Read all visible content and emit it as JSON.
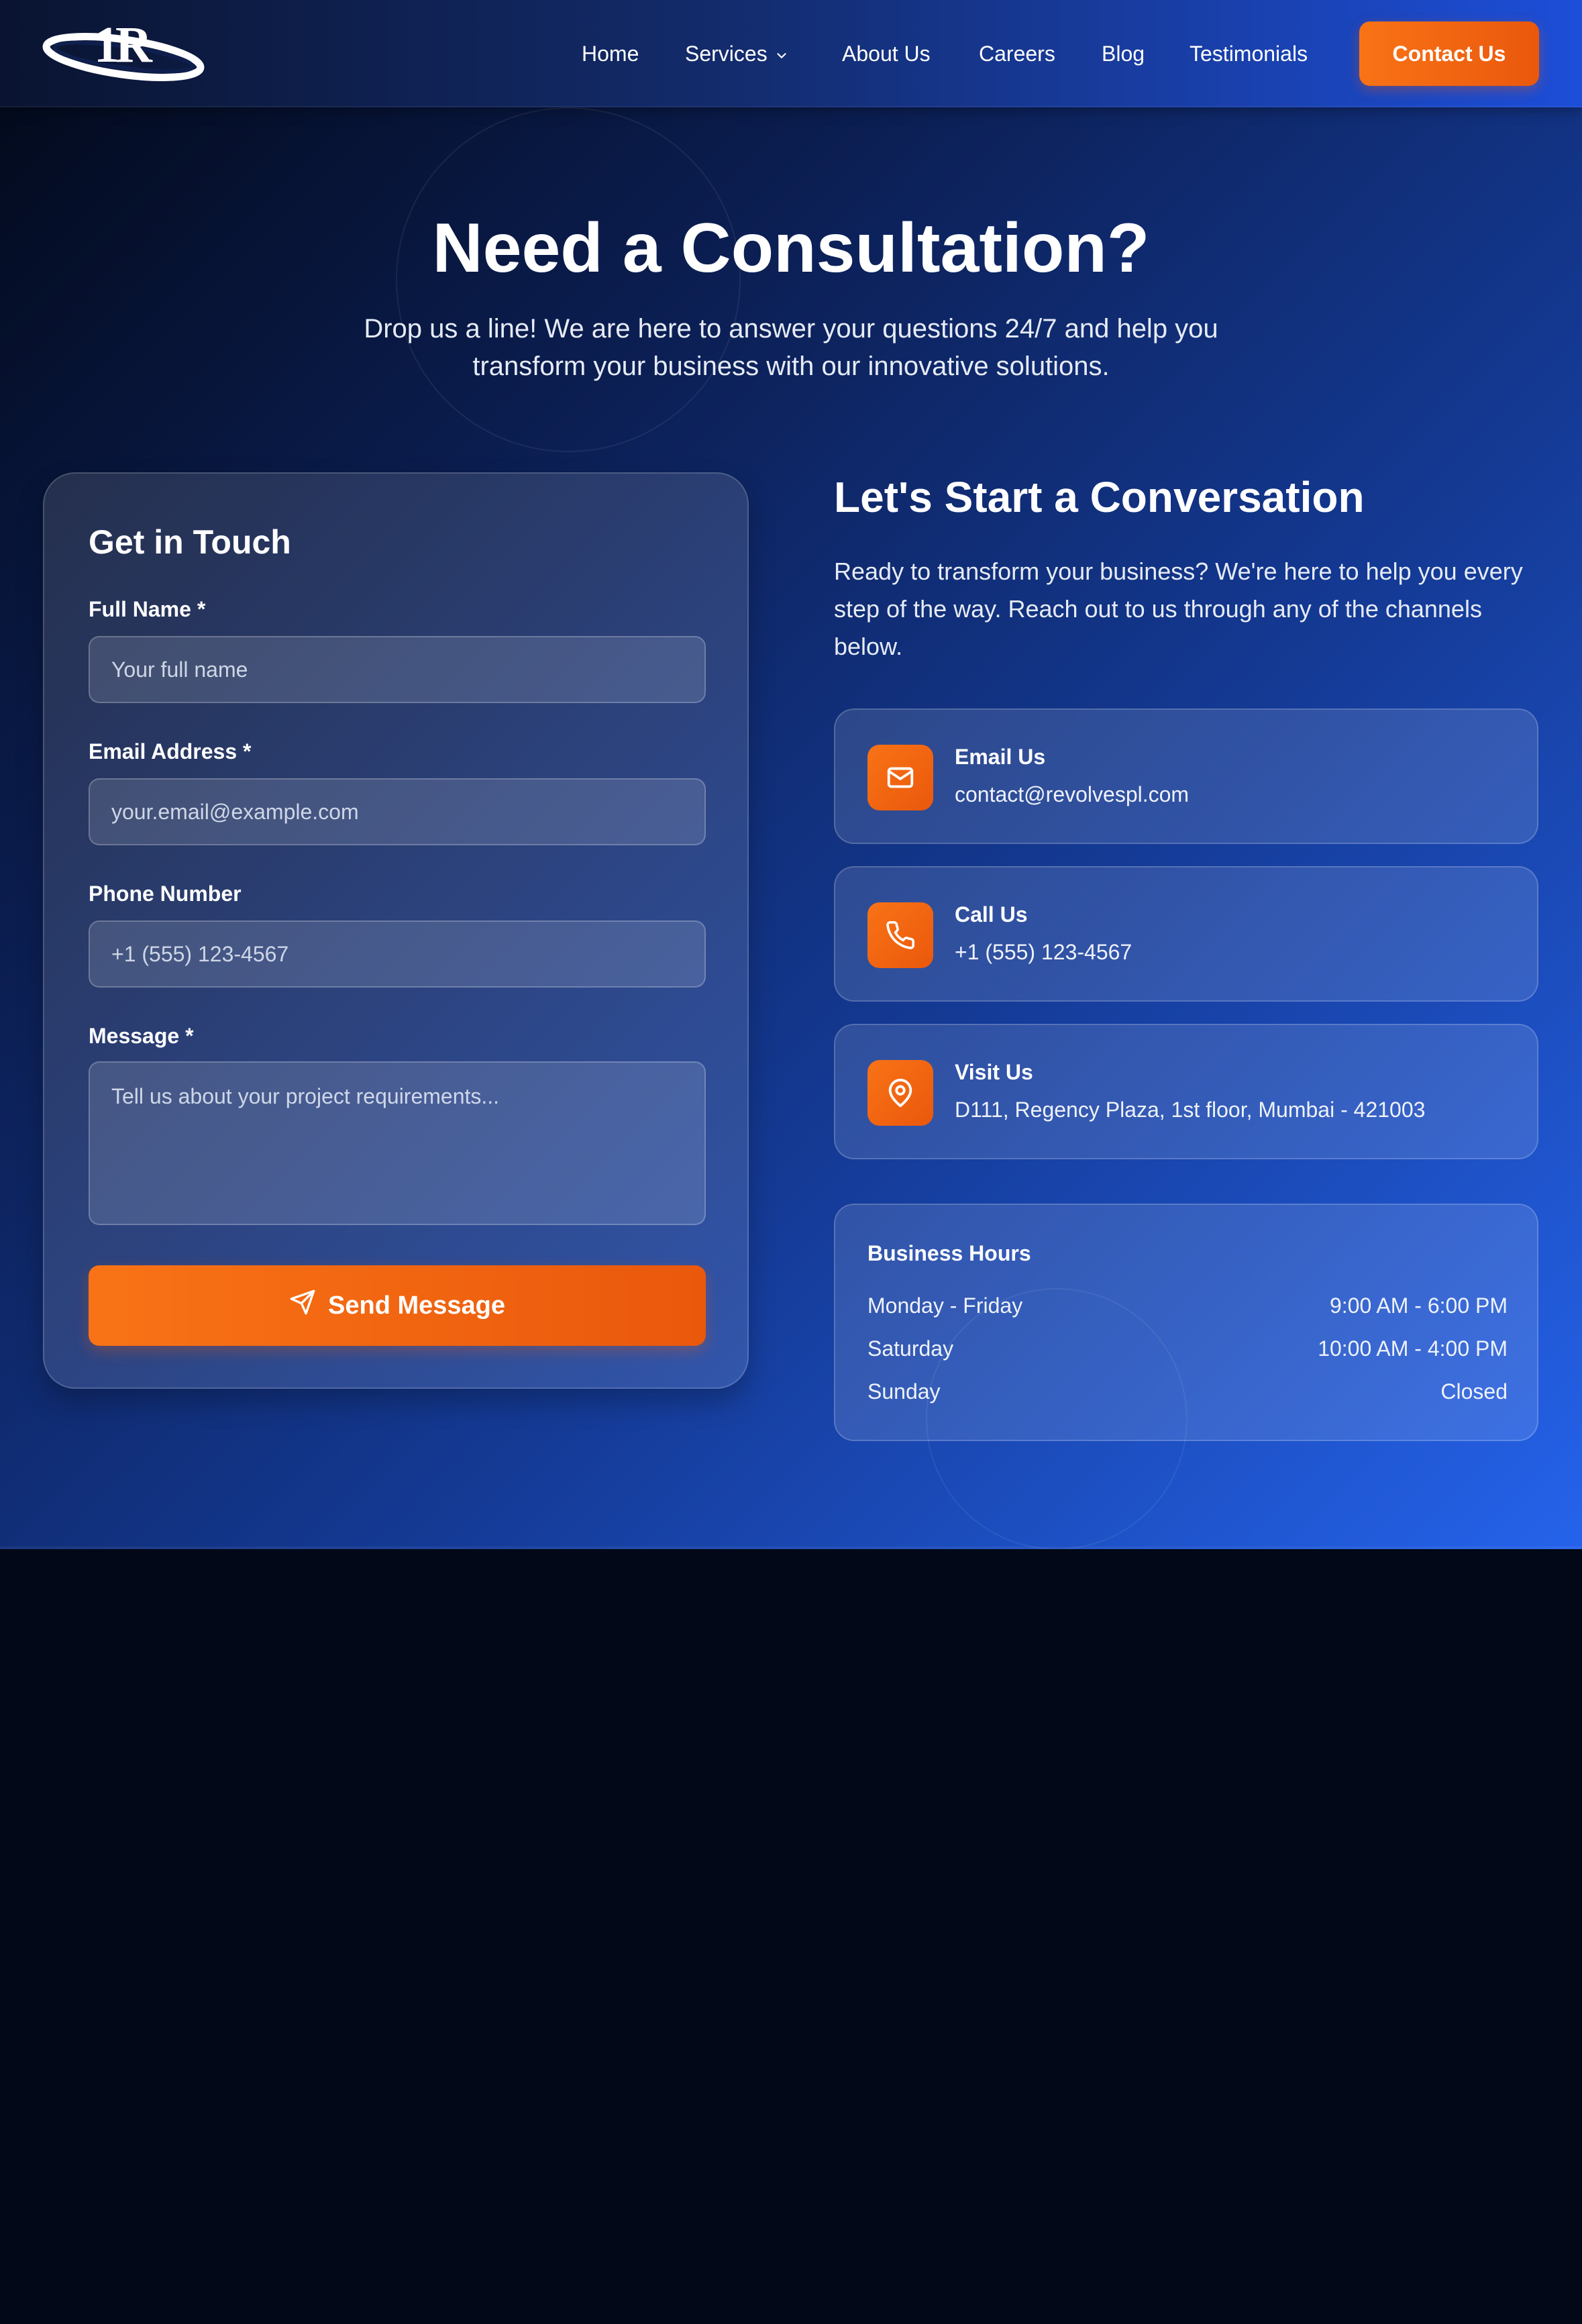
{
  "nav": {
    "logo_text": "R",
    "links": [
      "Home",
      "Services",
      "About Us",
      "Careers",
      "Blog",
      "Testimonials"
    ],
    "cta_label": "Contact Us"
  },
  "hero": {
    "title": "Need a Consultation?",
    "subtitle": "Drop us a line! We are here to answer your questions 24/7 and help you transform your business with our innovative solutions."
  },
  "form": {
    "title": "Get in Touch",
    "full_name_label": "Full Name *",
    "full_name_placeholder": "Your full name",
    "email_label": "Email Address *",
    "email_placeholder": "your.email@example.com",
    "phone_label": "Phone Number",
    "phone_placeholder": "+1 (555) 123-4567",
    "message_label": "Message *",
    "message_placeholder": "Tell us about your project requirements...",
    "submit_label": "Send Message"
  },
  "conversation": {
    "title": "Let's Start a Conversation",
    "text": "Ready to transform your business? We're here to help you every step of the way. Reach out to us through any of the channels below."
  },
  "contacts": [
    {
      "icon": "mail-icon",
      "label": "Email Us",
      "value": "contact@revolvespl.com"
    },
    {
      "icon": "phone-icon",
      "label": "Call Us",
      "value": "+1 (555) 123-4567"
    },
    {
      "icon": "map-pin-icon",
      "label": "Visit Us",
      "value": "D111, Regency Plaza, 1st floor, Mumbai - 421003"
    }
  ],
  "hours": {
    "title": "Business Hours",
    "rows": [
      {
        "day": "Monday - Friday",
        "time": "9:00 AM - 6:00 PM"
      },
      {
        "day": "Saturday",
        "time": "10:00 AM - 4:00 PM"
      },
      {
        "day": "Sunday",
        "time": "Closed"
      }
    ]
  },
  "colors": {
    "accent": "#f97316",
    "accent_dark": "#ea580c",
    "bg_dark": "#020817",
    "bg_blue": "#2563eb"
  }
}
